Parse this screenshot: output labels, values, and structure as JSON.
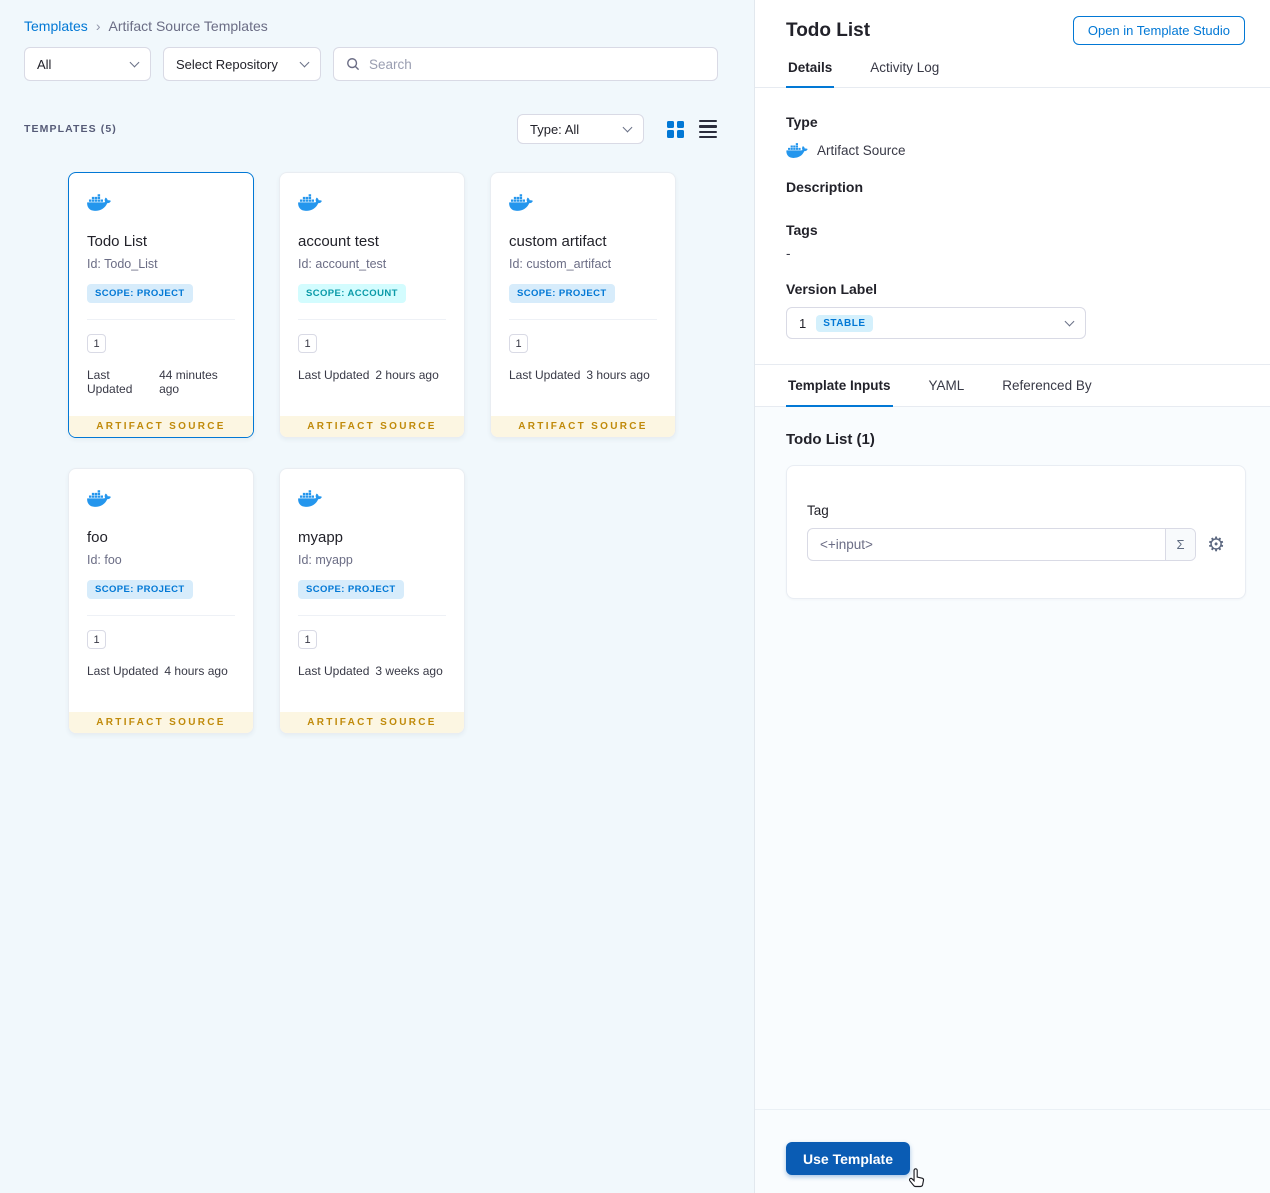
{
  "breadcrumb": {
    "parent": "Templates",
    "separator": "›",
    "current": "Artifact Source Templates"
  },
  "filters": {
    "scope": "All",
    "repository": "Select Repository",
    "search_placeholder": "Search"
  },
  "list_header": {
    "count": "TEMPLATES (5)",
    "type_filter": "Type: All"
  },
  "cards": [
    {
      "title": "Todo List",
      "id": "Id: Todo_List",
      "scope": "SCOPE: PROJECT",
      "version": "1",
      "updated_label": "Last Updated",
      "updated": "44 minutes ago",
      "footer": "ARTIFACT SOURCE"
    },
    {
      "title": "account test",
      "id": "Id: account_test",
      "scope": "SCOPE: ACCOUNT",
      "version": "1",
      "updated_label": "Last Updated",
      "updated": "2 hours ago",
      "footer": "ARTIFACT SOURCE"
    },
    {
      "title": "custom artifact",
      "id": "Id: custom_artifact",
      "scope": "SCOPE: PROJECT",
      "version": "1",
      "updated_label": "Last Updated",
      "updated": "3 hours ago",
      "footer": "ARTIFACT SOURCE"
    },
    {
      "title": "foo",
      "id": "Id: foo",
      "scope": "SCOPE: PROJECT",
      "version": "1",
      "updated_label": "Last Updated",
      "updated": "4 hours ago",
      "footer": "ARTIFACT SOURCE"
    },
    {
      "title": "myapp",
      "id": "Id: myapp",
      "scope": "SCOPE: PROJECT",
      "version": "1",
      "updated_label": "Last Updated",
      "updated": "3 weeks ago",
      "footer": "ARTIFACT SOURCE"
    }
  ],
  "panel": {
    "title": "Todo List",
    "open_studio": "Open in Template Studio",
    "tabs": {
      "details": "Details",
      "activity_log": "Activity Log"
    },
    "fields": {
      "type_label": "Type",
      "type_value": "Artifact Source",
      "description_label": "Description",
      "tags_label": "Tags",
      "tags_value": "-",
      "version_label": "Version Label",
      "version_value": "1",
      "version_badge": "STABLE"
    },
    "input_tabs": {
      "template_inputs": "Template Inputs",
      "yaml": "YAML",
      "referenced_by": "Referenced By"
    },
    "inputs": {
      "title": "Todo List (1)",
      "tag_label": "Tag",
      "tag_value": "<+input>"
    },
    "use_template": "Use Template"
  },
  "icons": {
    "sigma": "Σ",
    "gear": "⚙"
  },
  "colors": {
    "accent": "#0278d5",
    "primary_button": "#0a5cb4",
    "docker_blue": "#2496ED",
    "artifact_source_text": "#c08a0a",
    "artifact_source_bg": "#fcf6e2",
    "scope_project_bg": "#d7ecfb",
    "scope_project_text": "#0278d5",
    "scope_account_bg": "#d3fcfe",
    "scope_account_text": "#0a9aa8",
    "stable_bg": "#d4f0fc",
    "stable_text": "#0278d5"
  }
}
